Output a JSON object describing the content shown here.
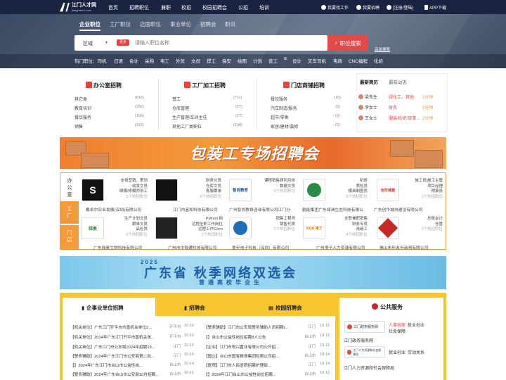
{
  "topnav": {
    "logo_title": "江门人才网",
    "logo_sub": "jiangmenrc.com",
    "items": [
      "首页",
      "招聘职位",
      "兼职",
      "校招",
      "校园招聘会",
      "公招",
      "培训"
    ],
    "right": [
      "我要找工作",
      "我要招聘",
      "[注册/登陆]",
      "APP下载"
    ]
  },
  "hero": {
    "tabs": [
      "企业职位",
      "工厂职位",
      "店面职位",
      "事业单位",
      "招聘会",
      "职讯"
    ],
    "region_label": "区域",
    "more_badge": "更多",
    "search_placeholder": "请输入职位名称",
    "search_button": "职位搜索",
    "advanced": "高级搜索",
    "hot_label": "热门职位：司机",
    "hot_items": [
      "日语",
      "会计",
      "采购",
      "电工",
      "外贸",
      "文员",
      "焊工",
      "保安",
      "绘图",
      "计划",
      "普工",
      "设计",
      "叉车司机",
      "电商",
      "CNC编程",
      "化验"
    ],
    "hot_extra": "IE"
  },
  "categories": [
    {
      "title": "办公室招聘",
      "rows": [
        [
          "其它类",
          "(816)"
        ],
        [
          "教育培训",
          "(256)"
        ],
        [
          "餐饮服务",
          "(106)"
        ],
        [
          "销售",
          "(115)"
        ]
      ]
    },
    {
      "title": "工厂加工招聘",
      "rows": [
        [
          "普工",
          "(711)"
        ],
        [
          "仓库管理",
          "(27)"
        ],
        [
          "生产管理/车间主任",
          "(27)"
        ],
        [
          "其他工厂类职位",
          "(108)"
        ]
      ]
    },
    {
      "title": "门店商铺招聘",
      "rows": [
        [
          "餐饮服务",
          "(10)"
        ],
        [
          "汽车制造/服务",
          "(9)"
        ],
        [
          "超市/零售",
          "(8)"
        ],
        [
          "家居/建材/装修",
          "(5)"
        ]
      ]
    }
  ],
  "resumes": {
    "tabs": [
      "最新简历",
      "最新动态"
    ],
    "rows": [
      {
        "name": "梁先生",
        "job": "绿化工，其他",
        "time": "2分钟"
      },
      {
        "name": "李女士",
        "job": "财务",
        "time": "2分钟"
      },
      {
        "name": "王女士",
        "job": "服装/纺织/皮革...",
        "time": "2分钟"
      }
    ]
  },
  "banner1": {
    "text": "包装工专场招聘会"
  },
  "companies": {
    "sidebar": [
      "办公室",
      "工厂",
      "门店"
    ],
    "row1": [
      {
        "jobs": [
          "市场营销、策划",
          "收发文员",
          "倒模/修模师员工"
        ],
        "count": "5个热招职位",
        "name": "戴卓尔实业发展(深圳)有限公司",
        "logo": "S",
        "logo_color": "#111"
      },
      {
        "jobs": [
          "财务文员",
          "仓库文员",
          "客服跟单"
        ],
        "count": "6个热招职位",
        "name": "江门市富和科技有限公司",
        "logo": "",
        "logo_color": "#111"
      },
      {
        "jobs": [
          "课程销售顾问月休",
          "数据文员"
        ],
        "count": "2个热招职位",
        "name": "广州智尚教育咨询有限公司江门分",
        "logo": "智尚教育",
        "logo_color": "#1f4f96"
      },
      {
        "jobs": [
          "机修",
          "质检员",
          "模具制图员"
        ],
        "count": "5个热招职位",
        "name": "鹤能集团广东绿洲生态科技有限公",
        "logo": "",
        "logo_color": "#2a8a4a"
      },
      {
        "jobs": [
          "施工员|施工主管",
          "项目经理",
          "预算员"
        ],
        "count": "1个热招职位",
        "name": "广东创华城市建设有限公司",
        "logo": "创华城建",
        "logo_color": "#c62828"
      }
    ],
    "row2": [
      {
        "jobs": [
          "生产计划文员",
          "跟单文员",
          "品检员"
        ],
        "count": "6个热招职位",
        "name": "广东绿奥生物科技有限公司",
        "logo": "绿奥",
        "logo_color": "#3b8a3b"
      },
      {
        "jobs": [
          "Python 网",
          "远程全职工作岗位",
          "远程工作Coco"
        ],
        "count": "1个热招职位",
        "name": "广州市中软通科技有限公司",
        "logo": "",
        "logo_color": "#222"
      },
      {
        "jobs": [
          "销售工程师",
          "销售代表"
        ],
        "count": "2个热招职位",
        "name": "盈天电子科技（深圳）有限公司",
        "logo": "",
        "logo_color": "#1e6fb8"
      },
      {
        "jobs": [
          "全职兼职销售",
          "财务专员",
          "洗碗工"
        ],
        "count": "4个热招职位",
        "name": "广州揸子人力资源有限公司",
        "logo": "XIQU 禧了",
        "logo_color": "#e07a10"
      },
      {
        "jobs": [
          "总账会计",
          "仓管"
        ],
        "count": "2个热招职位",
        "name": "佛山市乐友乐商贸有限公司",
        "logo": "",
        "logo_color": "#c62828"
      }
    ]
  },
  "banner2": {
    "year": "2025",
    "main": "广东省 秋季网络双选会",
    "sub": "普通高校毕业生"
  },
  "lists": {
    "tabs": [
      "企事业单位招聘",
      "招聘会",
      "校园招聘会"
    ],
    "left": [
      {
        "t": "【机关单位】广东江门开平市市直机关单位2...",
        "l": "开平市",
        "d": "10-16"
      },
      {
        "t": "【机关单位】2024年广东江门开平市直机关单...",
        "l": "开平市",
        "d": "10-16"
      },
      {
        "t": "【机关单位】广东江门市公安局2024年招聘19...",
        "l": "江门",
        "d": "10-16"
      },
      {
        "t": "【警务辅助】2024年广东江门市公安局第二批...",
        "l": "江门",
        "d": "10-16"
      },
      {
        "t": "【】2024年广东江门市台山市公益性岗...",
        "l": "台山市",
        "d": "10-14"
      },
      {
        "t": "【警务辅助】2024年广东台山市公安局10月招聘...",
        "l": "台山市",
        "d": "10-11"
      }
    ],
    "right": [
      {
        "t": "【警务辅助】江门市公安局警务辅助人员招聘(...",
        "l": "江门",
        "d": "10-15"
      },
      {
        "t": "【】台山市公益性岗位招聘8人公告",
        "l": "台山市",
        "d": "10-15"
      },
      {
        "t": "【企业】江门市悦兴置业有限公司公开招...",
        "l": "江门",
        "d": "10-15"
      },
      {
        "t": "【国企】台山市国有粮食集团有限公司招...",
        "l": "台山市",
        "d": "10-14"
      },
      {
        "t": "【医院】江门市人民医院招聘护理部...",
        "l": "江门",
        "d": "10-14"
      },
      {
        "t": "【】2024年江门台山市公益性岗位招聘...",
        "l": "台山市",
        "d": "10-12"
      }
    ]
  },
  "services": {
    "title": "公共服务",
    "items": [
      {
        "logo": "江门政务服务网",
        "links": [
          "人事档案",
          "就业创业",
          "社会保障"
        ],
        "caption": "江门政务服务网"
      },
      {
        "logo": "江门人力资源和社会保障局",
        "links": [
          "就业创业",
          "劳动关系"
        ],
        "caption": "江门人力资源和社会保障局"
      }
    ]
  }
}
